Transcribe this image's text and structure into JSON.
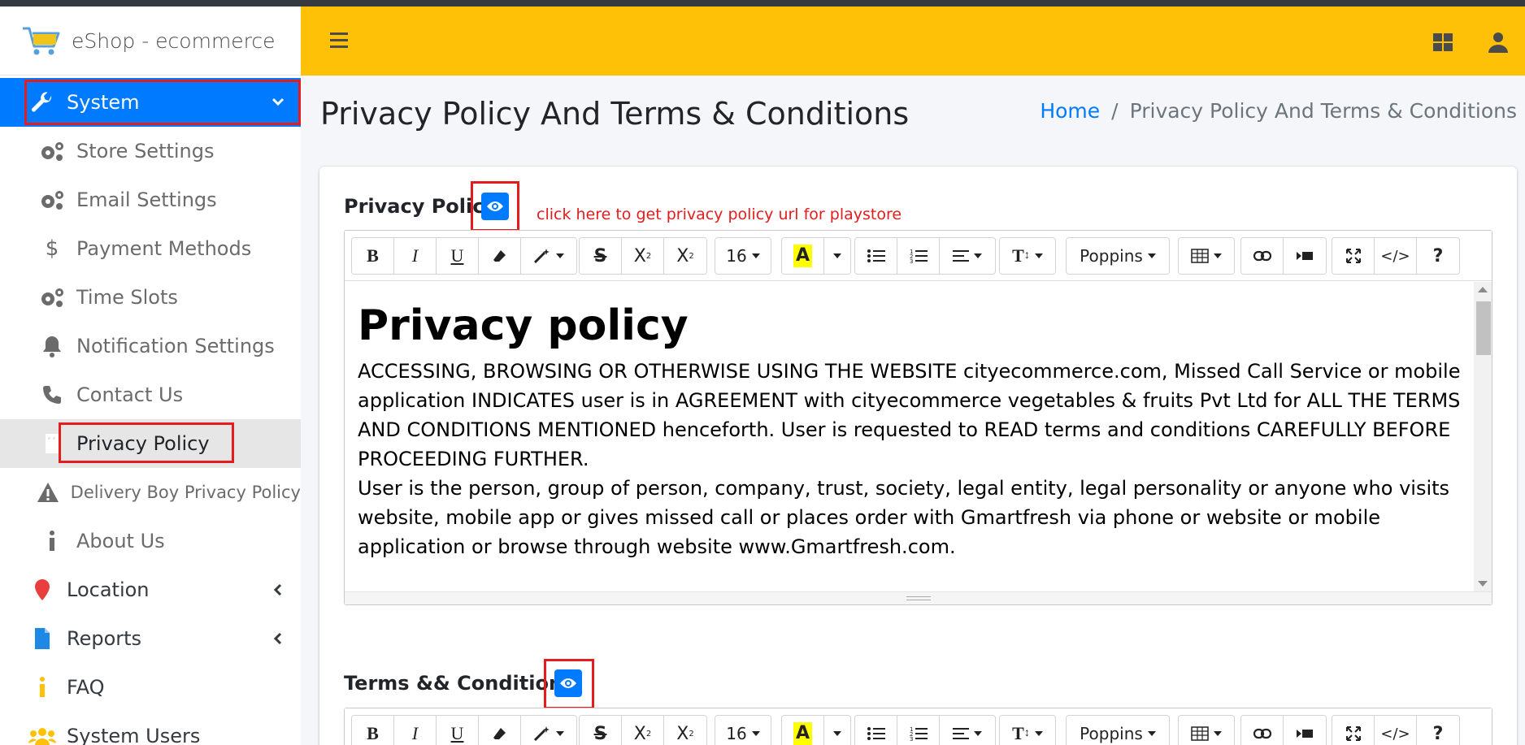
{
  "app": {
    "brand_name": "eShop - ecommerce",
    "header_color": "#ffc107",
    "accent": "#007bff",
    "highlight": "#e41c1c"
  },
  "sidebar": {
    "system": {
      "label": "System",
      "icon": "wrench-icon"
    },
    "sub_items": [
      {
        "label": "Store Settings",
        "icon": "cogs-icon"
      },
      {
        "label": "Email Settings",
        "icon": "cogs-icon"
      },
      {
        "label": "Payment Methods",
        "icon": "dollar-icon"
      },
      {
        "label": "Time Slots",
        "icon": "cogs-icon"
      },
      {
        "label": "Notification Settings",
        "icon": "bell-icon"
      },
      {
        "label": "Contact Us",
        "icon": "phone-icon"
      },
      {
        "label": "Privacy Policy",
        "icon": "building-icon"
      },
      {
        "label": "Delivery Boy Privacy Policy",
        "icon": "warning-icon"
      },
      {
        "label": "About Us",
        "icon": "info-icon"
      }
    ],
    "items": [
      {
        "label": "Location",
        "icon": "map-marker-icon"
      },
      {
        "label": "Reports",
        "icon": "file-icon"
      },
      {
        "label": "FAQ",
        "icon": "info-icon"
      },
      {
        "label": "System Users",
        "icon": "users-icon"
      }
    ]
  },
  "page": {
    "title": "Privacy Policy And Terms & Conditions",
    "breadcrumb": {
      "home": "Home",
      "sep": "/",
      "current": "Privacy Policy And Terms & Conditions"
    }
  },
  "privacy": {
    "label": "Privacy Policy",
    "hint": "click here to get privacy policy url for playstore",
    "heading": "Privacy policy",
    "paragraph1": "ACCESSING, BROWSING OR OTHERWISE USING THE WEBSITE cityecommerce.com, Missed Call Service or mobile application INDICATES user is in AGREEMENT with cityecommerce vegetables & fruits Pvt Ltd for ALL THE TERMS AND CONDITIONS MENTIONED henceforth. User is requested to READ terms and conditions CAREFULLY BEFORE PROCEEDING FURTHER.",
    "paragraph2": "User is the person, group of person, company, trust, society, legal entity, legal personality or anyone who visits website, mobile app or gives missed call or places order with Gmartfresh via phone or website or mobile application or browse through website www.Gmartfresh.com."
  },
  "terms": {
    "label": "Terms && Conditions"
  },
  "toolbar": {
    "font_size": "16",
    "font_name": "Poppins",
    "code_label": "</>",
    "help_label": "?"
  }
}
